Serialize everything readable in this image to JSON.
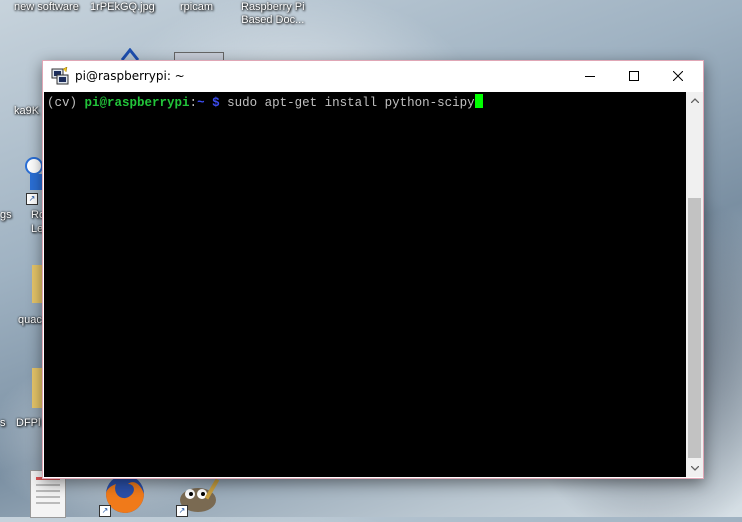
{
  "desktop": {
    "top_labels": [
      "new software",
      "1rPEkGQ.jpg",
      "rpicam",
      "Raspberry Pi",
      "Based Doc..."
    ],
    "left_labels": [
      "ka9K",
      "gs",
      "Ro",
      "Le",
      "quac",
      "s",
      "DFPl"
    ]
  },
  "window": {
    "title": "pi@raspberrypi: ~"
  },
  "terminal": {
    "env": "(cv) ",
    "user_host": "pi@raspberrypi",
    "sep": ":",
    "path": "~ $",
    "command": " sudo apt-get install python-scipy"
  },
  "colors": {
    "user_host": "#22c43a",
    "path": "#3c4df0",
    "cursor": "#00ff00",
    "terminal_bg": "#000000"
  },
  "icons": [
    "putty-icon",
    "minimize-icon",
    "maximize-icon",
    "close-icon",
    "firefox-icon",
    "gimp-icon",
    "folder-icon",
    "document-icon"
  ]
}
